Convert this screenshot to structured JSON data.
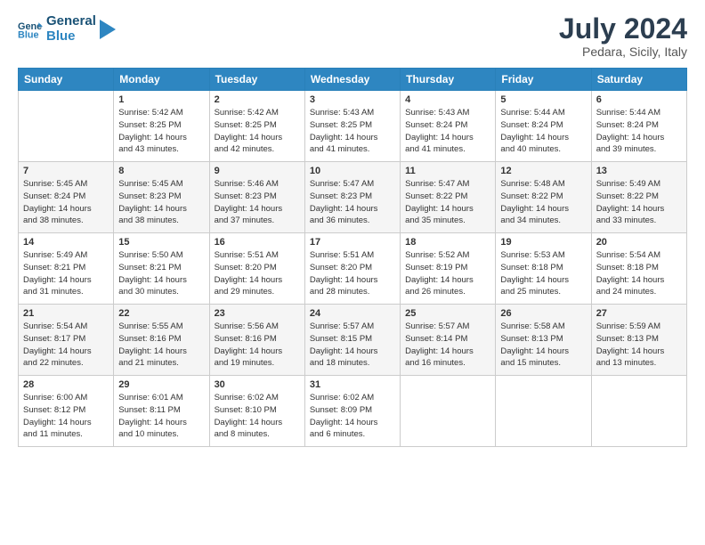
{
  "logo": {
    "text_general": "General",
    "text_blue": "Blue"
  },
  "header": {
    "month_year": "July 2024",
    "location": "Pedara, Sicily, Italy"
  },
  "weekdays": [
    "Sunday",
    "Monday",
    "Tuesday",
    "Wednesday",
    "Thursday",
    "Friday",
    "Saturday"
  ],
  "weeks": [
    [
      {
        "day": "",
        "sunrise": "",
        "sunset": "",
        "daylight": ""
      },
      {
        "day": "1",
        "sunrise": "Sunrise: 5:42 AM",
        "sunset": "Sunset: 8:25 PM",
        "daylight": "Daylight: 14 hours and 43 minutes."
      },
      {
        "day": "2",
        "sunrise": "Sunrise: 5:42 AM",
        "sunset": "Sunset: 8:25 PM",
        "daylight": "Daylight: 14 hours and 42 minutes."
      },
      {
        "day": "3",
        "sunrise": "Sunrise: 5:43 AM",
        "sunset": "Sunset: 8:25 PM",
        "daylight": "Daylight: 14 hours and 41 minutes."
      },
      {
        "day": "4",
        "sunrise": "Sunrise: 5:43 AM",
        "sunset": "Sunset: 8:24 PM",
        "daylight": "Daylight: 14 hours and 41 minutes."
      },
      {
        "day": "5",
        "sunrise": "Sunrise: 5:44 AM",
        "sunset": "Sunset: 8:24 PM",
        "daylight": "Daylight: 14 hours and 40 minutes."
      },
      {
        "day": "6",
        "sunrise": "Sunrise: 5:44 AM",
        "sunset": "Sunset: 8:24 PM",
        "daylight": "Daylight: 14 hours and 39 minutes."
      }
    ],
    [
      {
        "day": "7",
        "sunrise": "Sunrise: 5:45 AM",
        "sunset": "Sunset: 8:24 PM",
        "daylight": "Daylight: 14 hours and 38 minutes."
      },
      {
        "day": "8",
        "sunrise": "Sunrise: 5:45 AM",
        "sunset": "Sunset: 8:23 PM",
        "daylight": "Daylight: 14 hours and 38 minutes."
      },
      {
        "day": "9",
        "sunrise": "Sunrise: 5:46 AM",
        "sunset": "Sunset: 8:23 PM",
        "daylight": "Daylight: 14 hours and 37 minutes."
      },
      {
        "day": "10",
        "sunrise": "Sunrise: 5:47 AM",
        "sunset": "Sunset: 8:23 PM",
        "daylight": "Daylight: 14 hours and 36 minutes."
      },
      {
        "day": "11",
        "sunrise": "Sunrise: 5:47 AM",
        "sunset": "Sunset: 8:22 PM",
        "daylight": "Daylight: 14 hours and 35 minutes."
      },
      {
        "day": "12",
        "sunrise": "Sunrise: 5:48 AM",
        "sunset": "Sunset: 8:22 PM",
        "daylight": "Daylight: 14 hours and 34 minutes."
      },
      {
        "day": "13",
        "sunrise": "Sunrise: 5:49 AM",
        "sunset": "Sunset: 8:22 PM",
        "daylight": "Daylight: 14 hours and 33 minutes."
      }
    ],
    [
      {
        "day": "14",
        "sunrise": "Sunrise: 5:49 AM",
        "sunset": "Sunset: 8:21 PM",
        "daylight": "Daylight: 14 hours and 31 minutes."
      },
      {
        "day": "15",
        "sunrise": "Sunrise: 5:50 AM",
        "sunset": "Sunset: 8:21 PM",
        "daylight": "Daylight: 14 hours and 30 minutes."
      },
      {
        "day": "16",
        "sunrise": "Sunrise: 5:51 AM",
        "sunset": "Sunset: 8:20 PM",
        "daylight": "Daylight: 14 hours and 29 minutes."
      },
      {
        "day": "17",
        "sunrise": "Sunrise: 5:51 AM",
        "sunset": "Sunset: 8:20 PM",
        "daylight": "Daylight: 14 hours and 28 minutes."
      },
      {
        "day": "18",
        "sunrise": "Sunrise: 5:52 AM",
        "sunset": "Sunset: 8:19 PM",
        "daylight": "Daylight: 14 hours and 26 minutes."
      },
      {
        "day": "19",
        "sunrise": "Sunrise: 5:53 AM",
        "sunset": "Sunset: 8:18 PM",
        "daylight": "Daylight: 14 hours and 25 minutes."
      },
      {
        "day": "20",
        "sunrise": "Sunrise: 5:54 AM",
        "sunset": "Sunset: 8:18 PM",
        "daylight": "Daylight: 14 hours and 24 minutes."
      }
    ],
    [
      {
        "day": "21",
        "sunrise": "Sunrise: 5:54 AM",
        "sunset": "Sunset: 8:17 PM",
        "daylight": "Daylight: 14 hours and 22 minutes."
      },
      {
        "day": "22",
        "sunrise": "Sunrise: 5:55 AM",
        "sunset": "Sunset: 8:16 PM",
        "daylight": "Daylight: 14 hours and 21 minutes."
      },
      {
        "day": "23",
        "sunrise": "Sunrise: 5:56 AM",
        "sunset": "Sunset: 8:16 PM",
        "daylight": "Daylight: 14 hours and 19 minutes."
      },
      {
        "day": "24",
        "sunrise": "Sunrise: 5:57 AM",
        "sunset": "Sunset: 8:15 PM",
        "daylight": "Daylight: 14 hours and 18 minutes."
      },
      {
        "day": "25",
        "sunrise": "Sunrise: 5:57 AM",
        "sunset": "Sunset: 8:14 PM",
        "daylight": "Daylight: 14 hours and 16 minutes."
      },
      {
        "day": "26",
        "sunrise": "Sunrise: 5:58 AM",
        "sunset": "Sunset: 8:13 PM",
        "daylight": "Daylight: 14 hours and 15 minutes."
      },
      {
        "day": "27",
        "sunrise": "Sunrise: 5:59 AM",
        "sunset": "Sunset: 8:13 PM",
        "daylight": "Daylight: 14 hours and 13 minutes."
      }
    ],
    [
      {
        "day": "28",
        "sunrise": "Sunrise: 6:00 AM",
        "sunset": "Sunset: 8:12 PM",
        "daylight": "Daylight: 14 hours and 11 minutes."
      },
      {
        "day": "29",
        "sunrise": "Sunrise: 6:01 AM",
        "sunset": "Sunset: 8:11 PM",
        "daylight": "Daylight: 14 hours and 10 minutes."
      },
      {
        "day": "30",
        "sunrise": "Sunrise: 6:02 AM",
        "sunset": "Sunset: 8:10 PM",
        "daylight": "Daylight: 14 hours and 8 minutes."
      },
      {
        "day": "31",
        "sunrise": "Sunrise: 6:02 AM",
        "sunset": "Sunset: 8:09 PM",
        "daylight": "Daylight: 14 hours and 6 minutes."
      },
      {
        "day": "",
        "sunrise": "",
        "sunset": "",
        "daylight": ""
      },
      {
        "day": "",
        "sunrise": "",
        "sunset": "",
        "daylight": ""
      },
      {
        "day": "",
        "sunrise": "",
        "sunset": "",
        "daylight": ""
      }
    ]
  ]
}
